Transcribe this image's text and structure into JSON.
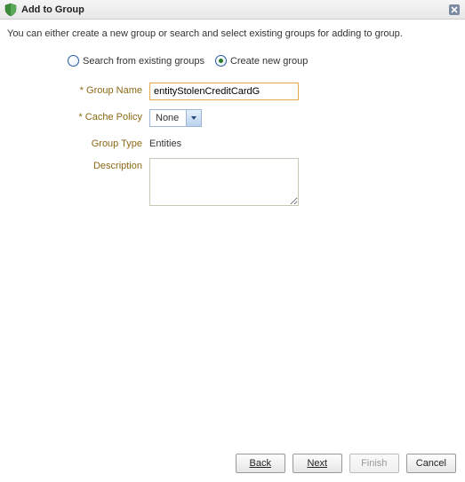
{
  "titlebar": {
    "title": "Add to Group"
  },
  "instruction": "You can either create a new group or search and select existing groups for adding to group.",
  "radios": {
    "search_label": "Search from existing groups",
    "create_label": "Create new group",
    "selected": "create"
  },
  "form": {
    "group_name": {
      "label": "Group Name",
      "value": "entityStolenCreditCardG",
      "required": true
    },
    "cache_policy": {
      "label": "Cache Policy",
      "value": "None",
      "required": true
    },
    "group_type": {
      "label": "Group Type",
      "value": "Entities"
    },
    "description": {
      "label": "Description",
      "value": ""
    }
  },
  "buttons": {
    "back": "Back",
    "next": "Next",
    "finish": "Finish",
    "cancel": "Cancel"
  }
}
